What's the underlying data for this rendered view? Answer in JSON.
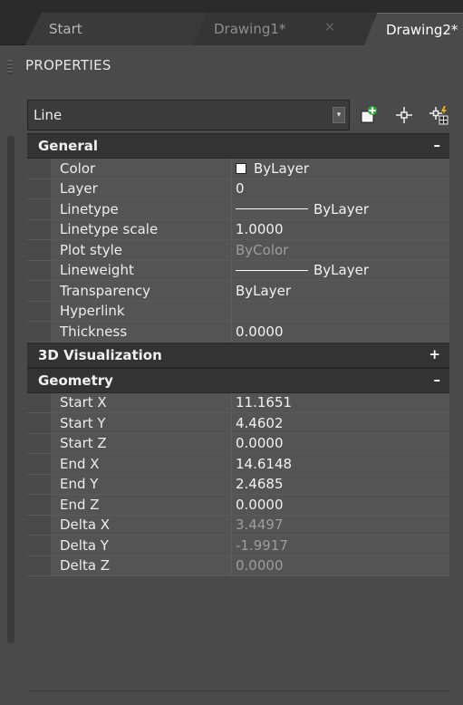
{
  "tabs": [
    {
      "label": "Start"
    },
    {
      "label": "Drawing1*",
      "close": "×"
    },
    {
      "label": "Drawing2*"
    }
  ],
  "panel": {
    "title": "PROPERTIES"
  },
  "selector": {
    "value": "Line",
    "arrow": "▾"
  },
  "toolbar": {
    "icons": [
      "quick-select-icon",
      "select-objects-icon",
      "toggle-pickadd-icon"
    ]
  },
  "categories": {
    "general": {
      "label": "General",
      "toggle": "–",
      "rows": [
        {
          "label": "Color",
          "value": "ByLayer"
        },
        {
          "label": "Layer",
          "value": "0"
        },
        {
          "label": "Linetype",
          "value": "ByLayer"
        },
        {
          "label": "Linetype scale",
          "value": "1.0000"
        },
        {
          "label": "Plot style",
          "value": "ByColor"
        },
        {
          "label": "Lineweight",
          "value": "ByLayer"
        },
        {
          "label": "Transparency",
          "value": "ByLayer"
        },
        {
          "label": "Hyperlink",
          "value": ""
        },
        {
          "label": "Thickness",
          "value": "0.0000"
        }
      ]
    },
    "viz3d": {
      "label": "3D Visualization",
      "toggle": "+"
    },
    "geometry": {
      "label": "Geometry",
      "toggle": "–",
      "rows": [
        {
          "label": "Start X",
          "value": "11.1651"
        },
        {
          "label": "Start Y",
          "value": "4.4602"
        },
        {
          "label": "Start Z",
          "value": "0.0000"
        },
        {
          "label": "End X",
          "value": "14.6148"
        },
        {
          "label": "End Y",
          "value": "2.4685"
        },
        {
          "label": "End Z",
          "value": "0.0000"
        },
        {
          "label": "Delta X",
          "value": "3.4497"
        },
        {
          "label": "Delta Y",
          "value": "-1.9917"
        },
        {
          "label": "Delta Z",
          "value": "0.0000"
        }
      ]
    }
  },
  "colors": {
    "panel_bg": "#4a4a4a",
    "row_bg": "#545454",
    "category_bg": "#333333",
    "dim_text": "#9d9d9d"
  }
}
